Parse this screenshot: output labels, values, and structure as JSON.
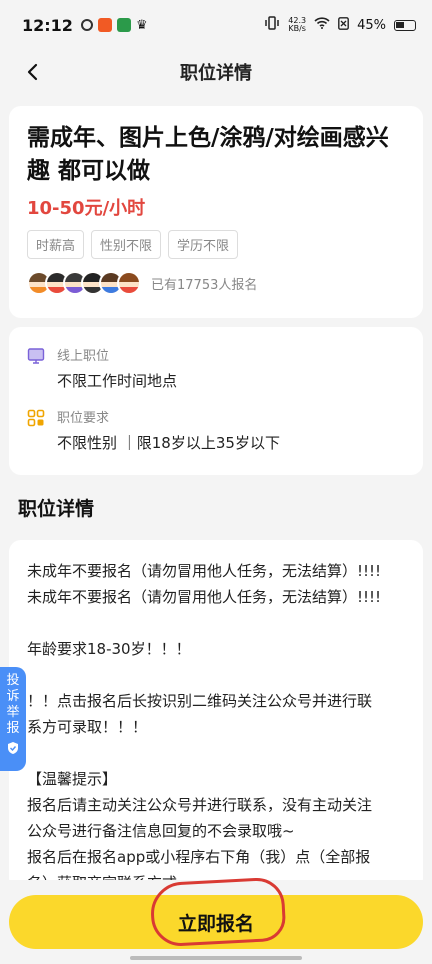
{
  "status": {
    "time": "12:12",
    "net_speed_top": "42.3",
    "net_speed_bottom": "KB/s",
    "battery_percent": "45%"
  },
  "nav": {
    "title": "职位详情",
    "back_icon": "chevron-left-icon"
  },
  "job": {
    "title": "需成年、图片上色/涂鸦/对绘画感兴趣 都可以做",
    "salary": "10-50元/小时",
    "tags": [
      "时薪高",
      "性别不限",
      "学历不限"
    ],
    "applicants_text": "已有17753人报名",
    "salary_color": "#e2473f"
  },
  "info": {
    "location_label": "线上职位",
    "location_value": "不限工作时间地点",
    "requirement_label": "职位要求",
    "requirement_value": "不限性别 ｜限18岁以上35岁以下"
  },
  "details": {
    "section_title": "职位详情",
    "lines": [
      "未成年不要报名（请勿冒用他人任务，无法结算）!!!!",
      "未成年不要报名（请勿冒用他人任务，无法结算）!!!!",
      "",
      "年龄要求18-30岁！！！",
      "",
      "！！点击报名后长按识别二维码关注公众号并进行联",
      "系方可录取！！！",
      "",
      "【温馨提示】",
      "报名后请主动关注公众号并进行联系，没有主动关注",
      "公众号进行备注信息回复的不会录取哦~",
      "报名后在报名app或小程序右下角（我）点（全部报",
      "名）获取商家联系方式"
    ]
  },
  "report": {
    "label": "投诉举报"
  },
  "actions": {
    "apply_label": "立即报名",
    "apply_color": "#fbd82b"
  }
}
